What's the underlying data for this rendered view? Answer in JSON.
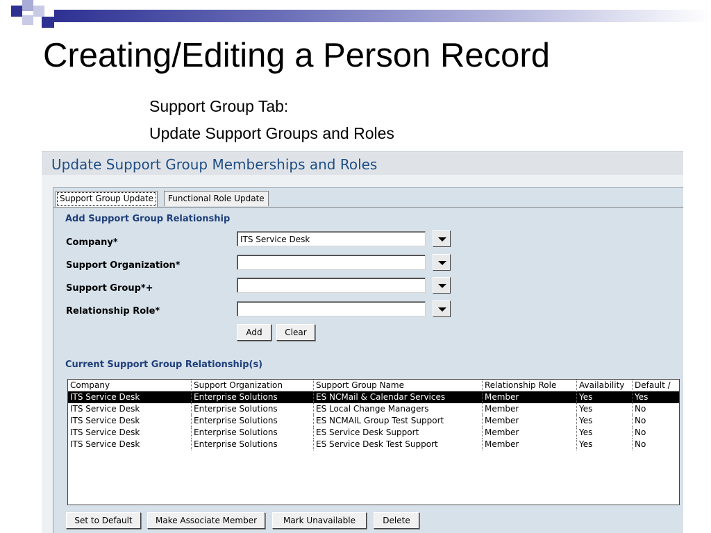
{
  "slide": {
    "title": "Creating/Editing a Person Record",
    "subtitle_line1": "Support Group Tab:",
    "subtitle_line2": "Update Support Groups and Roles"
  },
  "window": {
    "header": "Update Support Group Memberships and Roles",
    "tabs": [
      "Support Group Update",
      "Functional Role Update"
    ],
    "active_tab": "Support Group Update"
  },
  "form": {
    "section_title": "Add Support Group Relationship",
    "company_label": "Company*",
    "company_value": "ITS Service Desk",
    "support_org_label": "Support Organization*",
    "support_org_value": "",
    "support_group_label": "Support Group*+",
    "support_group_value": "",
    "relationship_role_label": "Relationship Role*",
    "relationship_role_value": "",
    "add_button": "Add",
    "clear_button": "Clear"
  },
  "relationships": {
    "section_title": "Current Support Group Relationship(s)",
    "columns": [
      "Company",
      "Support Organization",
      "Support Group Name",
      "Relationship Role",
      "Availability",
      "Default /"
    ],
    "rows": [
      [
        "ITS Service Desk",
        "Enterprise Solutions",
        "ES NCMail & Calendar Services",
        "Member",
        "Yes",
        "Yes"
      ],
      [
        "ITS Service Desk",
        "Enterprise Solutions",
        "ES Local Change Managers",
        "Member",
        "Yes",
        "No"
      ],
      [
        "ITS Service Desk",
        "Enterprise Solutions",
        "ES NCMAIL Group Test Support",
        "Member",
        "Yes",
        "No"
      ],
      [
        "ITS Service Desk",
        "Enterprise Solutions",
        "ES Service Desk Support",
        "Member",
        "Yes",
        "No"
      ],
      [
        "ITS Service Desk",
        "Enterprise Solutions",
        "ES Service Desk Test Support",
        "Member",
        "Yes",
        "No"
      ]
    ],
    "selected_row": 0
  },
  "actions": {
    "set_default": "Set to Default",
    "make_associate": "Make Associate Member",
    "mark_unavailable": "Mark Unavailable",
    "delete": "Delete"
  },
  "colors": {
    "accent_dark": "#2e3192",
    "accent_light": "#6b6fb8",
    "header_text": "#1e4e84",
    "panel_bg": "#d6e1ea",
    "section_title": "#1f3f7a"
  }
}
